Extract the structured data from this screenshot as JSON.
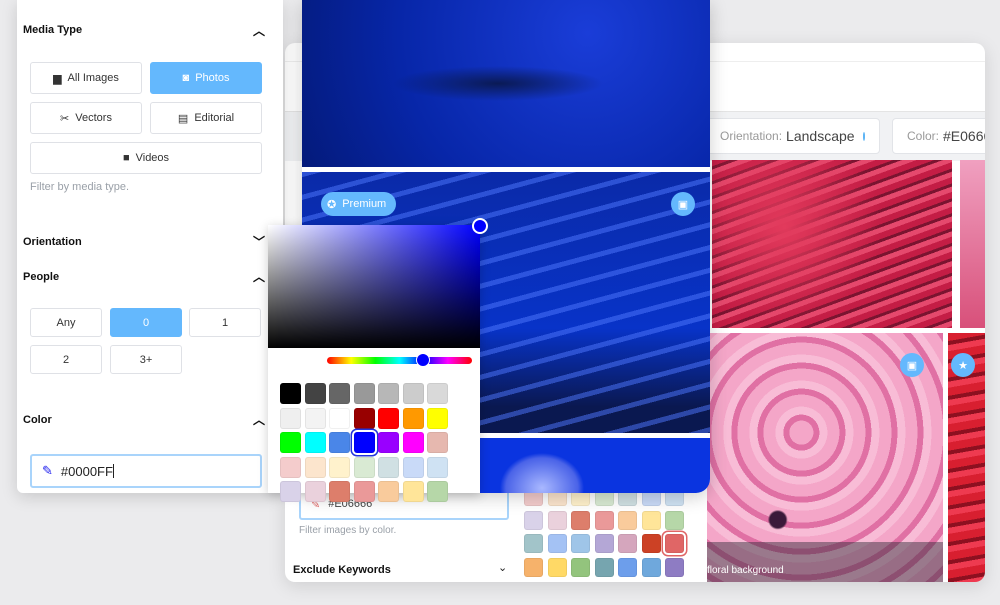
{
  "back_panel": {
    "chips": [
      {
        "label": "Orientation:",
        "value": "Landscape"
      },
      {
        "label": "Color:",
        "value": "#E0666"
      }
    ],
    "color_input": "#E06666",
    "color_hint": "Filter images by color.",
    "exclude_keywords": "Exclude Keywords",
    "image_caption": "floral background",
    "palette": [
      [
        "#f4cccc",
        "#fce5cd",
        "#fff2cc",
        "#d9ead3",
        "#d0e0e3",
        "#c9daf8",
        "#cfe2f3"
      ],
      [
        "#d9d2e9",
        "#ead1dc",
        "#dd7e6b",
        "#ea9999",
        "#f9cb9c",
        "#ffe599",
        "#b6d7a8"
      ],
      [
        "#a2c4c9",
        "#a4c2f4",
        "#9fc5e8",
        "#b4a7d6",
        "#d5a6bd",
        "#cc4125",
        "#e06666"
      ],
      [
        "#f6b26b",
        "#ffd966",
        "#93c47d",
        "#76a5af",
        "#6d9eeb",
        "#6fa8dc",
        "#8e7cc3"
      ]
    ],
    "palette_selected": "#e06666"
  },
  "photos": {
    "premium_label": "Premium"
  },
  "filters": {
    "media_type": {
      "title": "Media Type",
      "options": [
        "All Images",
        "Photos",
        "Vectors",
        "Editorial",
        "Videos"
      ],
      "selected": "Photos",
      "hint": "Filter by media type."
    },
    "orientation": {
      "title": "Orientation"
    },
    "people": {
      "title": "People",
      "options": [
        "Any",
        "0",
        "1",
        "2",
        "3+"
      ],
      "selected": "0"
    },
    "color": {
      "title": "Color",
      "value": "#0000FF"
    }
  },
  "picker": {
    "hue": "#0000ff",
    "swatches": [
      [
        "#000000",
        "#434343",
        "#666666",
        "#999999",
        "#b7b7b7",
        "#cccccc",
        "#d9d9d9"
      ],
      [
        "#efefef",
        "#f3f3f3",
        "#ffffff",
        "#980000",
        "#ff0000",
        "#ff9900",
        "#ffff00"
      ],
      [
        "#00ff00",
        "#00ffff",
        "#4a86e8",
        "#0000ff",
        "#9900ff",
        "#ff00ff",
        "#e6b8af"
      ],
      [
        "#f4cccc",
        "#fce5cd",
        "#fff2cc",
        "#d9ead3",
        "#d0e0e3",
        "#c9daf8",
        "#cfe2f3"
      ],
      [
        "#d9d2e9",
        "#ead1dc",
        "#dd7e6b",
        "#ea9999",
        "#f9cb9c",
        "#ffe599",
        "#b6d7a8"
      ]
    ],
    "selected": "#0000ff"
  },
  "accent": "#64b8fd"
}
